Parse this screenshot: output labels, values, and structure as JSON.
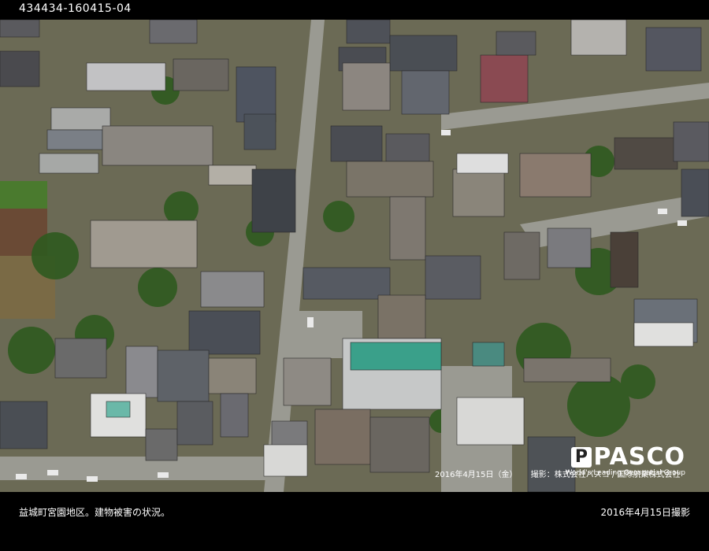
{
  "header": {
    "image_id": "434434-160415-04"
  },
  "photo": {
    "logo": {
      "brand": "PASCO",
      "tagline": "World's Leading Geospatial Group"
    },
    "credit": {
      "date": "2016年4月15日（金）",
      "photographer": "撮影：株式会社パスコ / 国際航業株式会社"
    }
  },
  "footer": {
    "caption": "益城町宮園地区。建物被害の状況。",
    "shot_date": "2016年4月15日撮影"
  }
}
